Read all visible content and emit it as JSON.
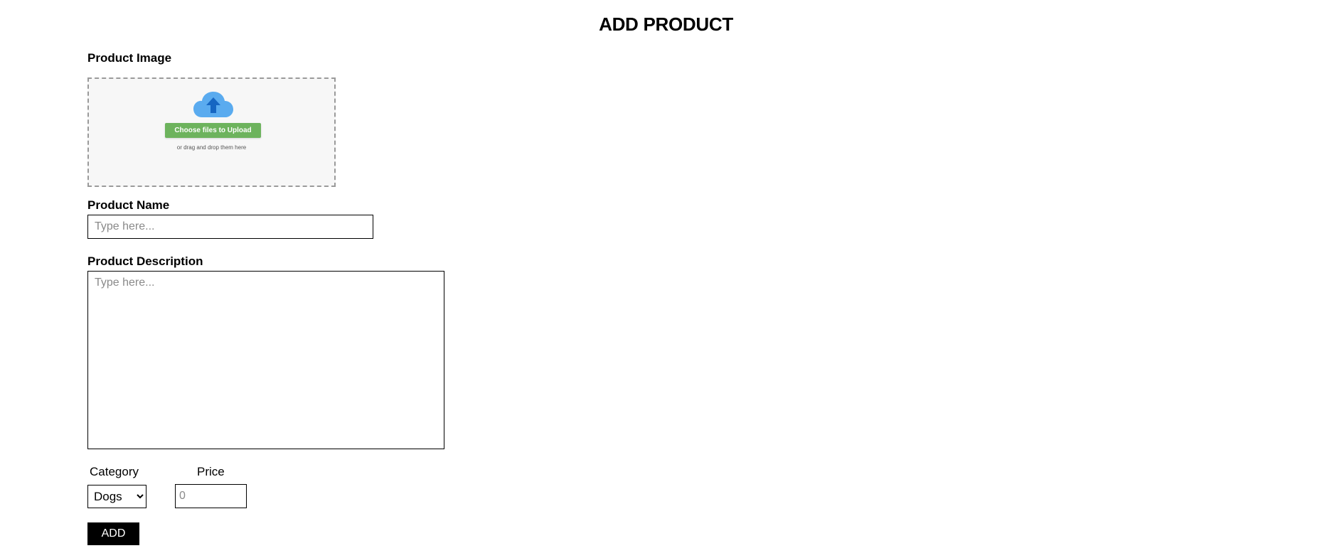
{
  "page": {
    "title": "ADD PRODUCT"
  },
  "product_image": {
    "label": "Product Image",
    "upload_button": "Choose files to Upload",
    "hint": "or drag and drop them here",
    "icon": "cloud-upload-icon",
    "button_color": "#6db35d",
    "icon_color": "#5aabef"
  },
  "product_name": {
    "label": "Product Name",
    "placeholder": "Type here..."
  },
  "product_description": {
    "label": "Product Description",
    "placeholder": "Type here..."
  },
  "category": {
    "label": "Category",
    "selected": "Dogs"
  },
  "price": {
    "label": "Price",
    "placeholder": "0"
  },
  "actions": {
    "add_label": "ADD"
  }
}
